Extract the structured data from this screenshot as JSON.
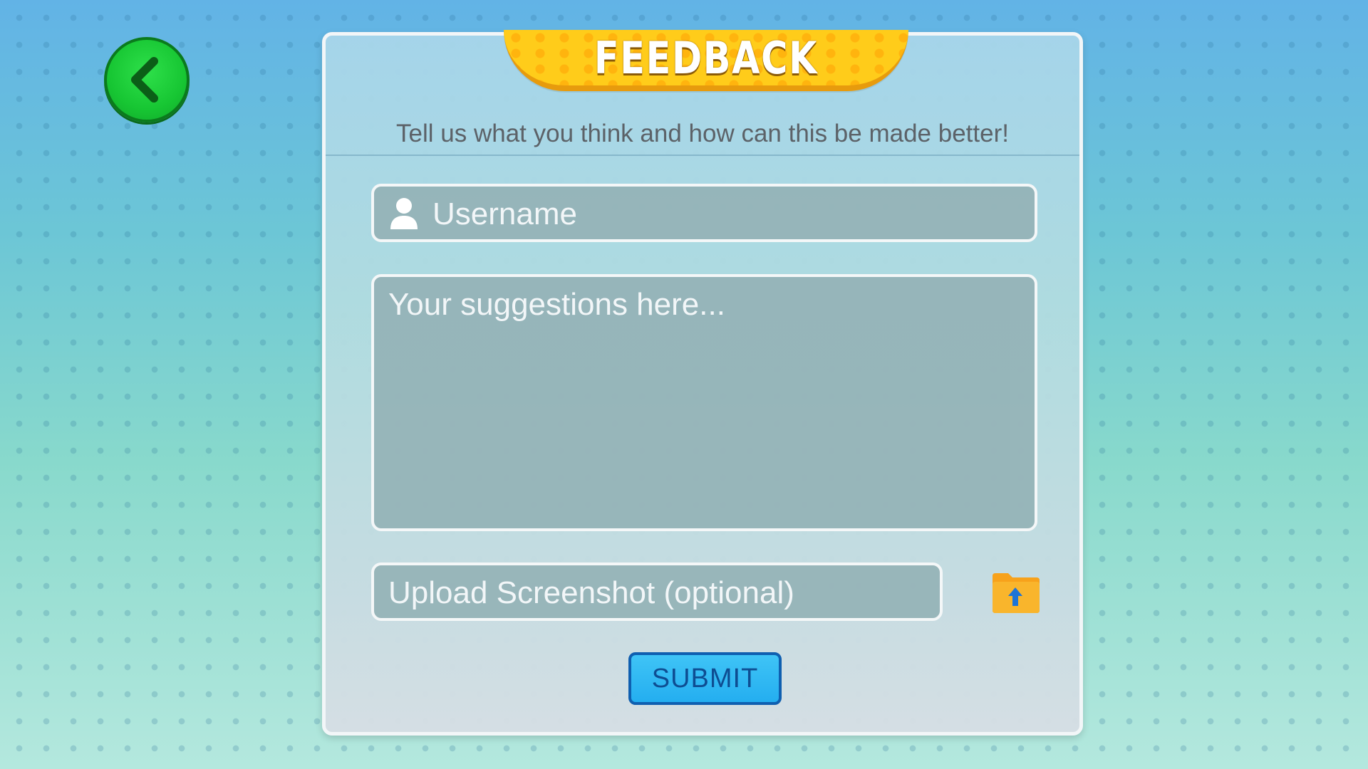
{
  "back_button": {
    "icon": "chevron-left-icon"
  },
  "panel": {
    "title": "FEEDBACK",
    "subtitle": "Tell us what you think and how can this be made better!"
  },
  "form": {
    "username": {
      "placeholder": "Username",
      "icon": "user-icon"
    },
    "suggestions": {
      "placeholder": "Your suggestions here..."
    },
    "upload": {
      "placeholder": "Upload Screenshot (optional)",
      "icon": "folder-upload-icon"
    },
    "submit_label": "SUBMIT"
  },
  "colors": {
    "banner": "#ffcc1a",
    "back_button": "#17c633",
    "submit": "#24aef0"
  }
}
